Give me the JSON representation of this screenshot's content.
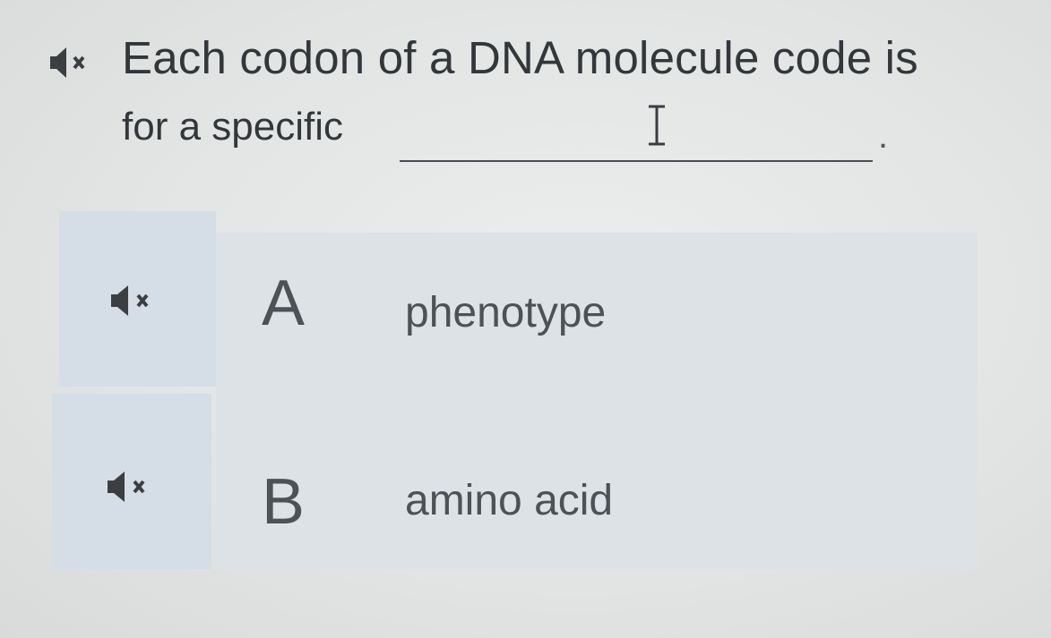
{
  "question": {
    "speaker_icon": "speaker-muted-icon",
    "line1": "Each codon of a DNA molecule code is",
    "line2": "for a specific",
    "blank_value": "",
    "end_punctuation": "."
  },
  "options": [
    {
      "letter": "A",
      "text": "phenotype",
      "speaker_icon": "speaker-muted-icon"
    },
    {
      "letter": "B",
      "text": "amino acid",
      "speaker_icon": "speaker-muted-icon"
    }
  ],
  "cursor": "text-ibeam-cursor"
}
